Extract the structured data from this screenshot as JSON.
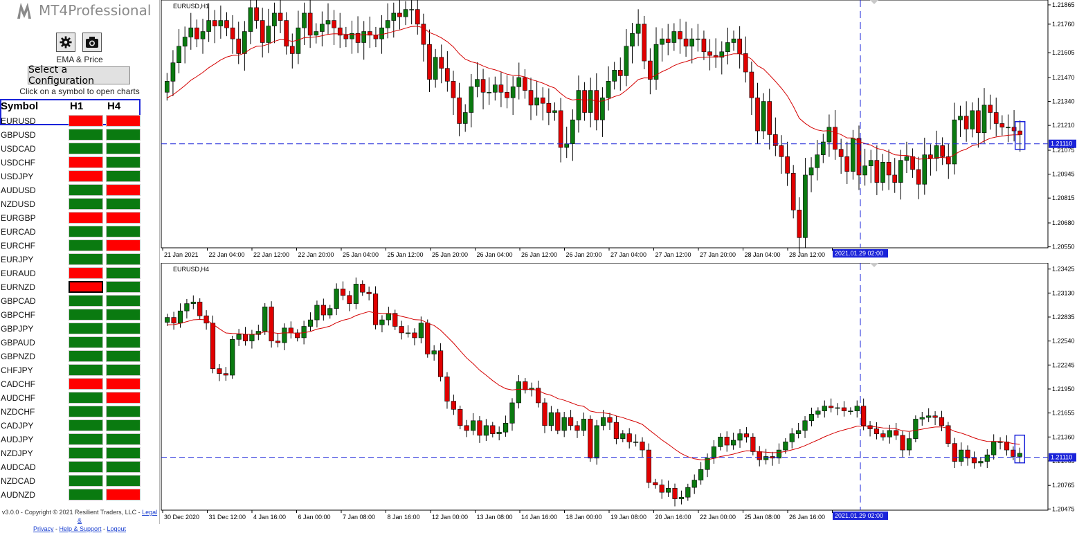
{
  "app": {
    "name": "MT4Professional"
  },
  "toolbar": {
    "settings_icon": "gear-icon",
    "screenshot_icon": "camera-icon",
    "preset_label": "EMA & Price",
    "config_button": "Select a Configuration",
    "hint": "Click on a symbol to open charts"
  },
  "table": {
    "headers": [
      "Symbol",
      "H1",
      "H4"
    ],
    "colors": {
      "up": "#0a7a10",
      "down": "#ff0000"
    },
    "rows": [
      {
        "symbol": "EURUSD",
        "h1": "down",
        "h4": "down"
      },
      {
        "symbol": "GBPUSD",
        "h1": "up",
        "h4": "up"
      },
      {
        "symbol": "USDCAD",
        "h1": "up",
        "h4": "up"
      },
      {
        "symbol": "USDCHF",
        "h1": "down",
        "h4": "up"
      },
      {
        "symbol": "USDJPY",
        "h1": "down",
        "h4": "up"
      },
      {
        "symbol": "AUDUSD",
        "h1": "up",
        "h4": "down"
      },
      {
        "symbol": "NZDUSD",
        "h1": "up",
        "h4": "up"
      },
      {
        "symbol": "EURGBP",
        "h1": "down",
        "h4": "down"
      },
      {
        "symbol": "EURCAD",
        "h1": "up",
        "h4": "up"
      },
      {
        "symbol": "EURCHF",
        "h1": "up",
        "h4": "down"
      },
      {
        "symbol": "EURJPY",
        "h1": "up",
        "h4": "up"
      },
      {
        "symbol": "EURAUD",
        "h1": "down",
        "h4": "up"
      },
      {
        "symbol": "EURNZD",
        "h1": "down",
        "h4": "up"
      },
      {
        "symbol": "GBPCAD",
        "h1": "up",
        "h4": "up"
      },
      {
        "symbol": "GBPCHF",
        "h1": "up",
        "h4": "up"
      },
      {
        "symbol": "GBPJPY",
        "h1": "up",
        "h4": "up"
      },
      {
        "symbol": "GBPAUD",
        "h1": "up",
        "h4": "up"
      },
      {
        "symbol": "GBPNZD",
        "h1": "up",
        "h4": "up"
      },
      {
        "symbol": "CHFJPY",
        "h1": "up",
        "h4": "up"
      },
      {
        "symbol": "CADCHF",
        "h1": "down",
        "h4": "down"
      },
      {
        "symbol": "AUDCHF",
        "h1": "up",
        "h4": "down"
      },
      {
        "symbol": "NZDCHF",
        "h1": "up",
        "h4": "up"
      },
      {
        "symbol": "CADJPY",
        "h1": "up",
        "h4": "up"
      },
      {
        "symbol": "AUDJPY",
        "h1": "up",
        "h4": "up"
      },
      {
        "symbol": "NZDJPY",
        "h1": "up",
        "h4": "up"
      },
      {
        "symbol": "AUDCAD",
        "h1": "up",
        "h4": "up"
      },
      {
        "symbol": "NZDCAD",
        "h1": "up",
        "h4": "up"
      },
      {
        "symbol": "AUDNZD",
        "h1": "up",
        "h4": "down"
      }
    ]
  },
  "footer": {
    "version": "v3.0.0 - Copyright © 2021 Resilient Traders, LLC - ",
    "legal": "Legal &",
    "privacy": "Privacy",
    "sep1": " - ",
    "help": "Help & Support",
    "sep2": " - ",
    "logout": "Logout"
  },
  "chart_data": [
    {
      "type": "candlestick",
      "title": "EURUSD,H1",
      "ylim": [
        1.2053,
        1.2193
      ],
      "y_ticks": [
        "1.21865",
        "1.21760",
        "1.21605",
        "1.21470",
        "1.21340",
        "1.21210",
        "1.21075",
        "1.20945",
        "1.20815",
        "1.20680",
        "1.20550"
      ],
      "x_ticks": [
        "21 Jan 2021",
        "22 Jan 04:00",
        "22 Jan 12:00",
        "22 Jan 20:00",
        "25 Jan 04:00",
        "25 Jan 12:00",
        "25 Jan 20:00",
        "26 Jan 04:00",
        "26 Jan 12:00",
        "26 Jan 20:00",
        "27 Jan 04:00",
        "27 Jan 12:00",
        "27 Jan 20:00",
        "28 Jan 04:00",
        "28 Jan 12:00",
        "28"
      ],
      "current_price": "1.21110",
      "crosshair_time": "2021.01.29 02:00",
      "close": [
        1.2145,
        1.2155,
        1.2164,
        1.2169,
        1.2174,
        1.2168,
        1.2172,
        1.2178,
        1.2175,
        1.2178,
        1.2174,
        1.2168,
        1.216,
        1.2172,
        1.2185,
        1.2178,
        1.2166,
        1.2175,
        1.2182,
        1.2178,
        1.2164,
        1.216,
        1.2174,
        1.2182,
        1.217,
        1.2172,
        1.2176,
        1.2178,
        1.2174,
        1.217,
        1.2168,
        1.2171,
        1.2166,
        1.2172,
        1.217,
        1.2168,
        1.2174,
        1.2178,
        1.2182,
        1.218,
        1.2184,
        1.2184,
        1.2176,
        1.2165,
        1.2146,
        1.2158,
        1.2152,
        1.2145,
        1.2136,
        1.2122,
        1.2128,
        1.2142,
        1.2146,
        1.2139,
        1.2139,
        1.2143,
        1.2139,
        1.2136,
        1.2142,
        1.2147,
        1.214,
        1.2132,
        1.2136,
        1.2133,
        1.2128,
        1.2129,
        1.2109,
        1.2111,
        1.2124,
        1.214,
        1.2128,
        1.214,
        1.2124,
        1.2136,
        1.2145,
        1.2151,
        1.2148,
        1.2164,
        1.2171,
        1.2176,
        1.2156,
        1.2146,
        1.2165,
        1.2168,
        1.2166,
        1.2172,
        1.2168,
        1.2164,
        1.2168,
        1.2168,
        1.2161,
        1.2159,
        1.2158,
        1.2161,
        1.2166,
        1.2168,
        1.216,
        1.215,
        1.2136,
        1.2118,
        1.2134,
        1.2116,
        1.211,
        1.2104,
        1.2095,
        1.2075,
        1.206,
        1.2094,
        1.2098,
        1.2105,
        1.2112,
        1.212,
        1.2108,
        1.2104,
        1.2096,
        1.2114,
        1.2094,
        1.2099,
        1.2102,
        1.209,
        1.2101,
        1.2094,
        1.209,
        1.2102,
        1.2104,
        1.2097,
        1.2089,
        1.2105,
        1.2103,
        1.211,
        1.2104,
        1.21,
        1.2124,
        1.2126,
        1.2119,
        1.2129,
        1.2117,
        1.2132,
        1.2128,
        1.2122,
        1.212,
        1.212,
        1.2118,
        1.2116
      ]
    },
    {
      "type": "candlestick",
      "title": "EURUSD,H4",
      "ylim": [
        2.2063,
        1.2342
      ],
      "y_ticks": [
        "1.23425",
        "1.23130",
        "1.22835",
        "1.22540",
        "1.22245",
        "1.21950",
        "1.21655",
        "1.21360",
        "1.21065",
        "1.20765",
        "1.20475"
      ],
      "x_ticks": [
        "30 Dec 2020",
        "31 Dec 12:00",
        "4 Jan 16:00",
        "6 Jan 00:00",
        "7 Jan 08:00",
        "8 Jan 16:00",
        "12 Jan 00:00",
        "13 Jan 08:00",
        "14 Jan 16:00",
        "18 Jan 00:00",
        "19 Jan 08:00",
        "20 Jan 16:00",
        "22 Jan 00:00",
        "25 Jan 08:00",
        "26 Jan 16:00",
        "28"
      ],
      "current_price": "1.21110",
      "crosshair_time": "2021.01.29 02:00",
      "close": [
        1.2283,
        1.2276,
        1.2291,
        1.23,
        1.2302,
        1.2285,
        1.2276,
        1.222,
        1.2214,
        1.2212,
        1.2256,
        1.2262,
        1.2254,
        1.2262,
        1.2266,
        1.2296,
        1.2254,
        1.2252,
        1.227,
        1.2264,
        1.2258,
        1.2272,
        1.228,
        1.2298,
        1.2286,
        1.2294,
        1.2318,
        1.231,
        1.23,
        1.2324,
        1.2314,
        1.2312,
        1.2274,
        1.228,
        1.2288,
        1.2272,
        1.2264,
        1.2264,
        1.2258,
        1.2276,
        1.2238,
        1.2242,
        1.221,
        1.218,
        1.217,
        1.215,
        1.2144,
        1.2156,
        1.2138,
        1.215,
        1.214,
        1.2142,
        1.2153,
        1.2178,
        1.2204,
        1.2194,
        1.2196,
        1.2178,
        1.215,
        1.2166,
        1.2144,
        1.216,
        1.215,
        1.2144,
        1.2158,
        1.211,
        1.215,
        1.216,
        1.2154,
        1.2134,
        1.214,
        1.213,
        1.213,
        1.212,
        1.208,
        1.2077,
        1.2068,
        1.2073,
        1.206,
        1.2062,
        1.2074,
        1.2083,
        1.2096,
        1.211,
        1.2124,
        1.2136,
        1.2126,
        1.2132,
        1.214,
        1.2136,
        1.2118,
        1.2108,
        1.2112,
        1.211,
        1.212,
        1.213,
        1.214,
        1.2144,
        1.2156,
        1.2164,
        1.2168,
        1.2174,
        1.2172,
        1.2172,
        1.2168,
        1.2168,
        1.2174,
        1.215,
        1.2146,
        1.214,
        1.2136,
        1.2144,
        1.2138,
        1.212,
        1.2134,
        1.2158,
        1.216,
        1.2162,
        1.216,
        1.215,
        1.2128,
        1.2106,
        1.212,
        1.211,
        1.2104,
        1.2106,
        1.2114,
        1.213,
        1.213,
        1.212,
        1.2112,
        1.2116
      ]
    }
  ]
}
